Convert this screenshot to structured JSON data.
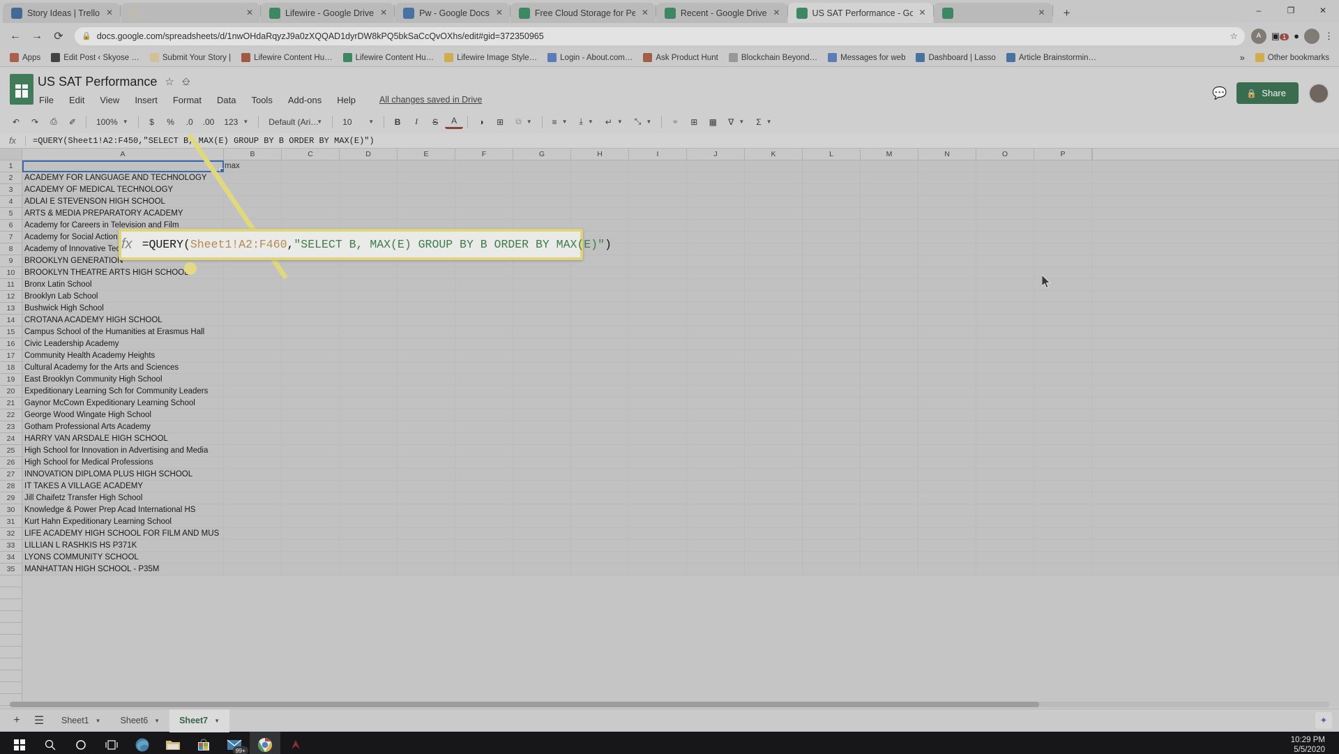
{
  "browser": {
    "tabs": [
      {
        "title": "Story Ideas | Trello",
        "favicon": "trello-icon",
        "color": "#2a72c4",
        "active": false
      },
      {
        "title": "",
        "favicon": "blank-icon",
        "color": "#c7c3b4",
        "active": false
      },
      {
        "title": "Lifewire - Google Drive",
        "favicon": "google-drive-icon",
        "color": "#0f9d58",
        "active": false
      },
      {
        "title": "Pw - Google Docs",
        "favicon": "google-docs-icon",
        "color": "#2b7cd3",
        "active": false
      },
      {
        "title": "Free Cloud Storage for Pers",
        "favicon": "google-drive-icon",
        "color": "#0f9d58",
        "active": false
      },
      {
        "title": "Recent - Google Drive",
        "favicon": "google-drive-icon",
        "color": "#0f9d58",
        "active": false
      },
      {
        "title": "US SAT Performance - Goo",
        "favicon": "google-sheets-icon",
        "color": "#0f9d58",
        "active": true
      },
      {
        "title": "",
        "favicon": "google-sheets-icon",
        "color": "#0f9d58",
        "active": false
      }
    ],
    "newtab_label": "+",
    "window_controls": [
      "–",
      "❐",
      "✕"
    ],
    "nav": {
      "back": "←",
      "forward": "→",
      "reload": "⟳"
    },
    "url": "docs.google.com/spreadsheets/d/1nwOHdaRqyzJ9a0zXQQAD1dyrDW8kPQ5bkSaCcQvOXhs/edit#gid=372350965",
    "lock_icon": "padlock-icon",
    "star_icon": "star-icon",
    "extension_badge": "1",
    "profile_initial": "",
    "menu_icon": "⋮",
    "bookmarks": [
      {
        "label": "Apps",
        "icon": "apps-grid-icon",
        "color": "#e8562f"
      },
      {
        "label": "Edit Post ‹ Skyose …",
        "icon": "wordpress-icon",
        "color": "#464646"
      },
      {
        "label": "Submit Your Story |",
        "icon": "page-icon",
        "color": "#e8c87a"
      },
      {
        "label": "Lifewire Content Hu…",
        "icon": "chrome-icon",
        "color": "#d9512c"
      },
      {
        "label": "Lifewire Content Hu…",
        "icon": "google-sheets-icon",
        "color": "#0f9d58"
      },
      {
        "label": "Lifewire Image Style…",
        "icon": "folder-icon",
        "color": "#f4b400"
      },
      {
        "label": "Login - About.com…",
        "icon": "globe-icon",
        "color": "#4285f4"
      },
      {
        "label": "Ask Product Hunt",
        "icon": "producthunt-icon",
        "color": "#da552f"
      },
      {
        "label": "Blockchain Beyond…",
        "icon": "page-icon",
        "color": "#9e9e9e"
      },
      {
        "label": "Messages for web",
        "icon": "messages-icon",
        "color": "#4285f4"
      },
      {
        "label": "Dashboard | Lasso",
        "icon": "lasso-icon",
        "color": "#2b7cd3"
      },
      {
        "label": "Article Brainstormin…",
        "icon": "google-docs-icon",
        "color": "#2b7cd3"
      }
    ],
    "bookmarks_overflow": "»",
    "other_bookmarks": "Other bookmarks",
    "other_bookmarks_icon": "folder-icon"
  },
  "sheets": {
    "doc_title": "US SAT Performance",
    "star_icon": "star-icon",
    "move_icon": "move-to-folder-icon",
    "menus": [
      "File",
      "Edit",
      "View",
      "Insert",
      "Format",
      "Data",
      "Tools",
      "Add-ons",
      "Help"
    ],
    "save_status": "All changes saved in Drive",
    "comment_icon": "comment-history-icon",
    "share_label": "Share",
    "share_icon": "lock-icon",
    "share_color": "#1d7b45",
    "toolbar": {
      "undo": "↶",
      "redo": "↷",
      "print": "⎙",
      "paint_format": "✐",
      "zoom_value": "100%",
      "currency": "$",
      "percent": "%",
      "decimal_decrease": ".0",
      "decimal_increase": ".00",
      "number_format": "123",
      "font_family": "Default (Ari…",
      "font_size": "10",
      "bold": "B",
      "italic": "I",
      "strikethrough": "S",
      "text_color": "A",
      "fill_color": "◑",
      "borders": "⊞",
      "merge_cells": "⧉",
      "horizontal_align": "≡",
      "vertical_align": "⤓",
      "text_wrap": "↵",
      "text_rotation": "⤡",
      "insert_link": "⚭",
      "insert_comment": "⊞",
      "insert_chart": "Ὄa",
      "filter": "∇",
      "functions": "Σ"
    },
    "formula_bar": {
      "fx_label": "fx",
      "formula": "=QUERY(Sheet1!A2:F450,\"SELECT B, MAX(E) GROUP BY B ORDER BY MAX(E)\")"
    },
    "name_box": "",
    "columns": [
      "A",
      "B",
      "C",
      "D",
      "E",
      "F",
      "G",
      "H",
      "I",
      "J",
      "K",
      "L",
      "M",
      "N",
      "O",
      "P"
    ],
    "selected_cell": "A1",
    "partial_cell_b1": "max",
    "rows": [
      {
        "n": "1",
        "a": ""
      },
      {
        "n": "2",
        "a": "ACADEMY FOR LANGUAGE AND TECHNOLOGY"
      },
      {
        "n": "3",
        "a": "ACADEMY OF MEDICAL TECHNOLOGY"
      },
      {
        "n": "4",
        "a": "ADLAI E STEVENSON HIGH SCHOOL"
      },
      {
        "n": "5",
        "a": "ARTS & MEDIA PREPARATORY ACADEMY"
      },
      {
        "n": "6",
        "a": "Academy for Careers in Television and Film"
      },
      {
        "n": "7",
        "a": "Academy for Social Action"
      },
      {
        "n": "8",
        "a": "Academy of Innovative Tech"
      },
      {
        "n": "9",
        "a": "BROOKLYN GENERATION"
      },
      {
        "n": "10",
        "a": "BROOKLYN THEATRE ARTS HIGH SCHOOL"
      },
      {
        "n": "11",
        "a": "Bronx Latin School"
      },
      {
        "n": "12",
        "a": "Brooklyn Lab School"
      },
      {
        "n": "13",
        "a": "Bushwick High School"
      },
      {
        "n": "14",
        "a": "CROTANA ACADEMY HIGH SCHOOL"
      },
      {
        "n": "15",
        "a": "Campus School of the Humanities at Erasmus Hall"
      },
      {
        "n": "16",
        "a": "Civic Leadership Academy"
      },
      {
        "n": "17",
        "a": "Community Health Academy Heights"
      },
      {
        "n": "18",
        "a": "Cultural Academy for the Arts and Sciences"
      },
      {
        "n": "19",
        "a": "East Brooklyn Community High School"
      },
      {
        "n": "20",
        "a": "Expeditionary Learning Sch for Community Leaders"
      },
      {
        "n": "21",
        "a": "Gaynor McCown Expeditionary Learning School"
      },
      {
        "n": "22",
        "a": "George Wood Wingate High School"
      },
      {
        "n": "23",
        "a": "Gotham Professional Arts Academy"
      },
      {
        "n": "24",
        "a": "HARRY VAN ARSDALE HIGH SCHOOL"
      },
      {
        "n": "25",
        "a": "High School for Innovation in Advertising and Media"
      },
      {
        "n": "26",
        "a": "High School for Medical Professions"
      },
      {
        "n": "27",
        "a": "INNOVATION DIPLOMA PLUS HIGH SCHOOL"
      },
      {
        "n": "28",
        "a": "IT TAKES A VILLAGE ACADEMY"
      },
      {
        "n": "29",
        "a": "Jill Chaifetz Transfer High School"
      },
      {
        "n": "30",
        "a": "Knowledge & Power Prep Acad International HS"
      },
      {
        "n": "31",
        "a": "Kurt Hahn Expeditionary Learning School"
      },
      {
        "n": "32",
        "a": "LIFE ACADEMY HIGH SCHOOL FOR FILM AND MUS"
      },
      {
        "n": "33",
        "a": "LILLIAN L RASHKIS HS P371K"
      },
      {
        "n": "34",
        "a": "LYONS COMMUNITY SCHOOL"
      },
      {
        "n": "35",
        "a": "MANHATTAN HIGH SCHOOL - P35M"
      }
    ],
    "sheet_tabs": [
      {
        "label": "Sheet1",
        "active": false
      },
      {
        "label": "Sheet6",
        "active": false
      },
      {
        "label": "Sheet7",
        "active": true
      }
    ],
    "add_sheet_icon": "plus-icon",
    "all_sheets_icon": "list-icon",
    "explore_icon": "explore-icon"
  },
  "callout": {
    "fx_label": "fx",
    "formula_parts": [
      {
        "text": "=QUERY(",
        "style": "plain"
      },
      {
        "text": "Sheet1!A2:F460",
        "style": "ref"
      },
      {
        "text": ",",
        "style": "plain"
      },
      {
        "text": "\"SELECT B, MAX(E) GROUP BY B ORDER BY MAX(E)\"",
        "style": "string"
      },
      {
        "text": ")",
        "style": "plain"
      }
    ],
    "border_color": "#f5e03a"
  },
  "taskbar": {
    "items": [
      {
        "name": "start-button",
        "icon": "windows-icon"
      },
      {
        "name": "search-button",
        "icon": "search-icon"
      },
      {
        "name": "cortana-button",
        "icon": "circle-icon"
      },
      {
        "name": "task-view-button",
        "icon": "task-view-icon"
      },
      {
        "name": "edge-button",
        "icon": "edge-icon"
      },
      {
        "name": "file-explorer-button",
        "icon": "folder-icon"
      },
      {
        "name": "microsoft-store-button",
        "icon": "store-icon"
      },
      {
        "name": "mail-button",
        "icon": "mail-icon",
        "badge": "99+"
      },
      {
        "name": "chrome-button",
        "icon": "chrome-icon"
      },
      {
        "name": "app-button",
        "icon": "red-app-icon"
      }
    ],
    "time": "10:29 PM",
    "date": "5/5/2020"
  }
}
